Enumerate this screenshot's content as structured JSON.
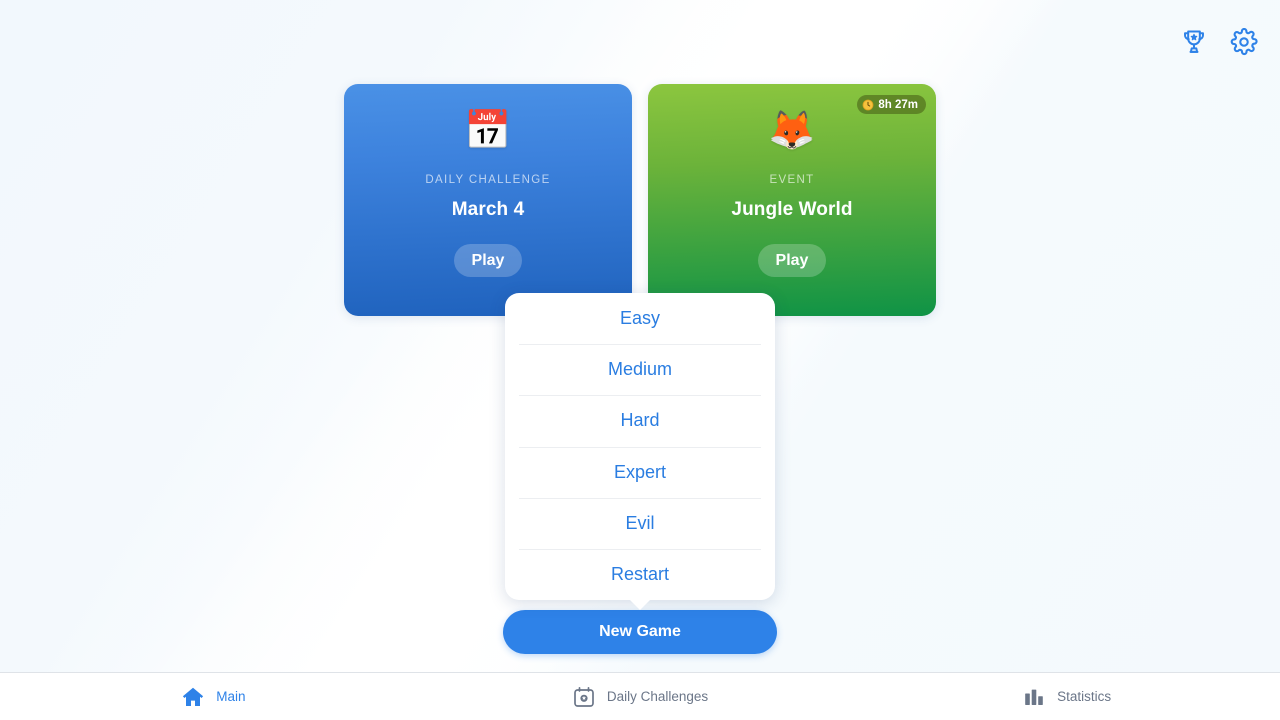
{
  "colors": {
    "accent_blue": "#2e82e8",
    "menu_blue": "#2a7de1",
    "nav_inactive": "#6b7688",
    "card_daily_from": "#4a91e6",
    "card_daily_to": "#1f62bd",
    "card_event_from": "#8cc63f",
    "card_event_to": "#0f9346",
    "badge_bg": "#4a6418",
    "background": "#f4f9fd"
  },
  "top_bar": {
    "icons": [
      {
        "name": "trophy-icon",
        "label": "Achievements"
      },
      {
        "name": "gear-icon",
        "label": "Settings"
      }
    ]
  },
  "cards": [
    {
      "kicker": "DAILY CHALLENGE",
      "title": "March 4",
      "play_label": "Play",
      "icon": "calendar-star-emoji",
      "badge": null
    },
    {
      "kicker": "EVENT",
      "title": "Jungle World",
      "play_label": "Play",
      "icon": "fox-jungle-emoji",
      "badge": {
        "icon": "clock-icon",
        "text": "8h 27m"
      }
    }
  ],
  "difficulty_menu": {
    "items": [
      {
        "label": "Easy"
      },
      {
        "label": "Medium"
      },
      {
        "label": "Hard"
      },
      {
        "label": "Expert"
      },
      {
        "label": "Evil"
      },
      {
        "label": "Restart"
      }
    ]
  },
  "new_game": {
    "label": "New Game"
  },
  "bottom_nav": {
    "items": [
      {
        "label": "Main",
        "icon": "home-icon",
        "active": true
      },
      {
        "label": "Daily Challenges",
        "icon": "calendar-star-icon",
        "active": false
      },
      {
        "label": "Statistics",
        "icon": "bar-chart-icon",
        "active": false
      }
    ]
  }
}
